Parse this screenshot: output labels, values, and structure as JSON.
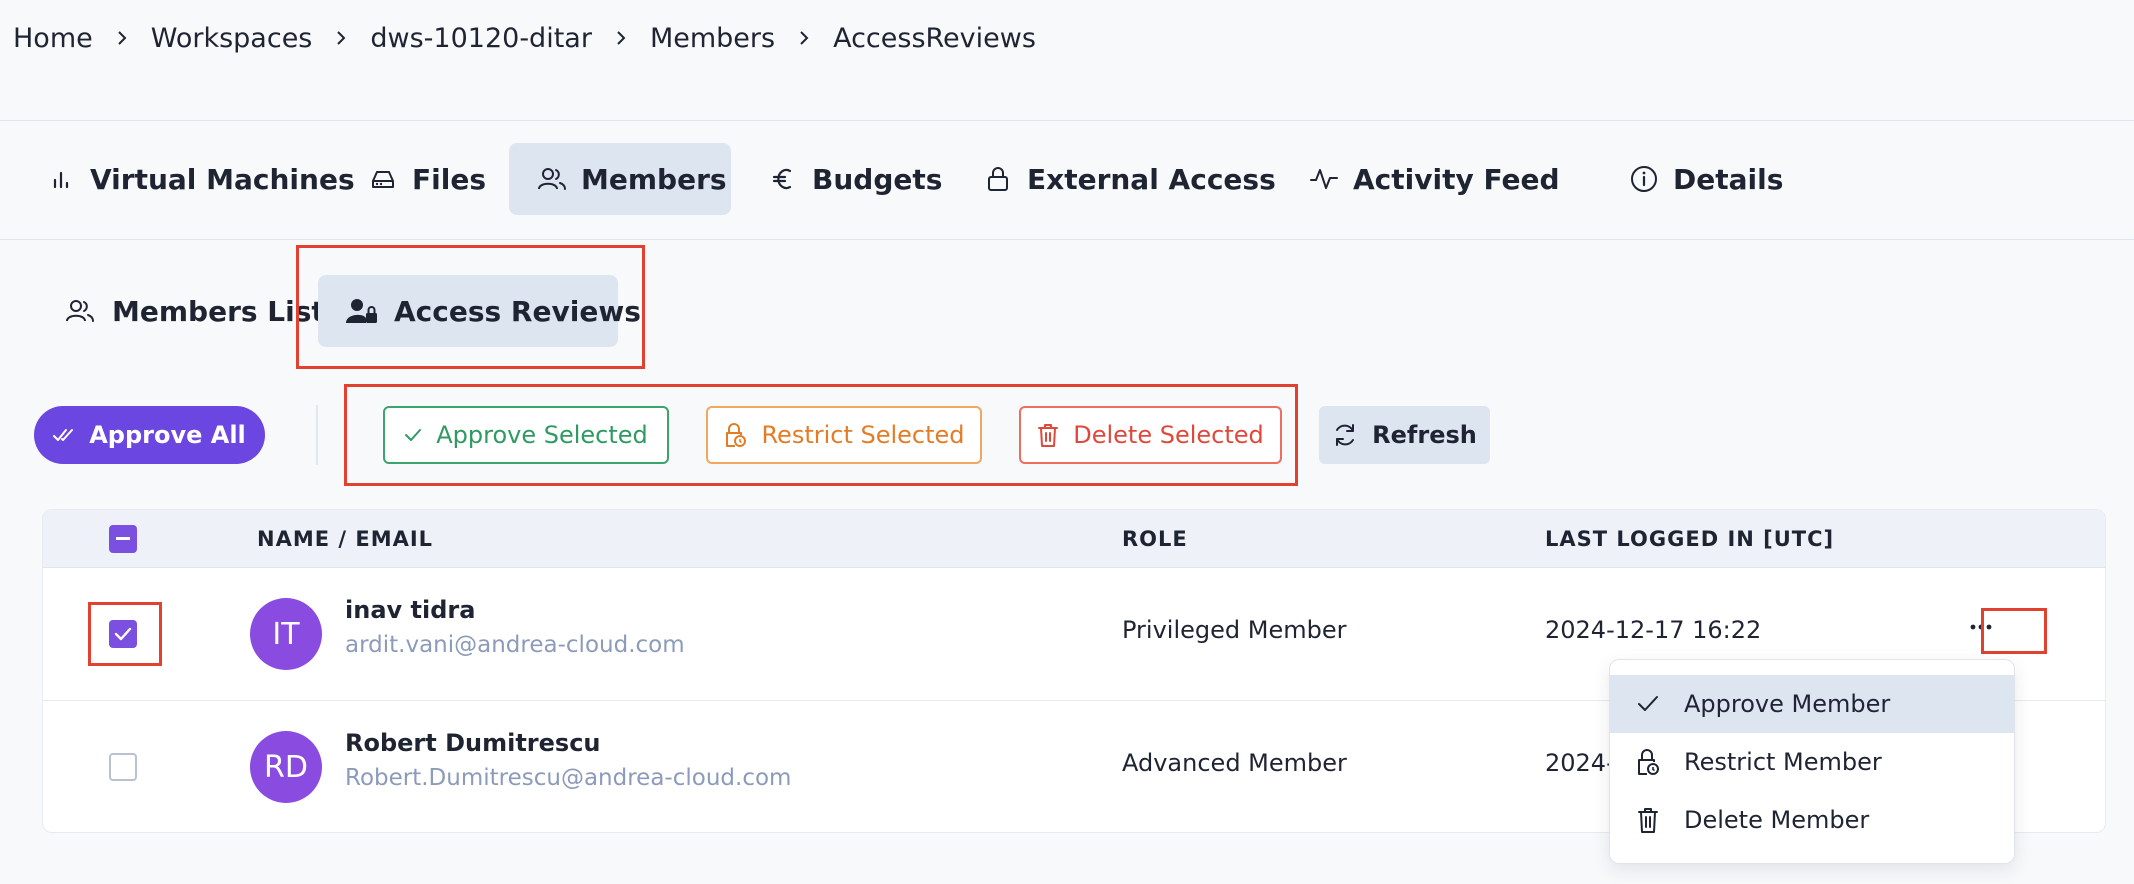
{
  "breadcrumb": [
    "Home",
    "Workspaces",
    "dws-10120-ditar",
    "Members",
    "AccessReviews"
  ],
  "tabs": [
    {
      "label": "Virtual Machines",
      "icon": "bar-chart-icon"
    },
    {
      "label": "Files",
      "icon": "drive-icon"
    },
    {
      "label": "Members",
      "icon": "users-icon",
      "active": true
    },
    {
      "label": "Budgets",
      "icon": "euro-icon"
    },
    {
      "label": "External Access",
      "icon": "lock-icon"
    },
    {
      "label": "Activity Feed",
      "icon": "activity-icon"
    },
    {
      "label": "Details",
      "icon": "info-icon"
    }
  ],
  "subtabs": [
    {
      "label": "Members List",
      "icon": "users-icon"
    },
    {
      "label": "Access Reviews",
      "icon": "user-lock-icon",
      "active": true
    }
  ],
  "actions": {
    "approve_all": "Approve All",
    "approve_selected": "Approve Selected",
    "restrict_selected": "Restrict Selected",
    "delete_selected": "Delete Selected",
    "refresh": "Refresh"
  },
  "table": {
    "headers": {
      "name": "NAME / EMAIL",
      "role": "ROLE",
      "last_login": "LAST LOGGED IN [UTC]"
    },
    "rows": [
      {
        "initials": "IT",
        "name": "inav tidra",
        "email": "ardit.vani@andrea-cloud.com",
        "role": "Privileged Member",
        "last_login": "2024-12-17 16:22",
        "checked": true
      },
      {
        "initials": "RD",
        "name": "Robert Dumitrescu",
        "email": "Robert.Dumitrescu@andrea-cloud.com",
        "role": "Advanced Member",
        "last_login": "2024-",
        "checked": false
      }
    ]
  },
  "row_menu": {
    "items": [
      {
        "label": "Approve Member",
        "icon": "check-icon"
      },
      {
        "label": "Restrict Member",
        "icon": "lock-icon"
      },
      {
        "label": "Delete Member",
        "icon": "trash-icon"
      }
    ]
  },
  "colors": {
    "primary": "#6b46e0",
    "approve": "#2f9a62",
    "restrict": "#e47c26",
    "delete": "#e0483c",
    "highlight": "#e2412f",
    "avatar": "#8a4be0",
    "active_tab": "#dde5f1"
  }
}
